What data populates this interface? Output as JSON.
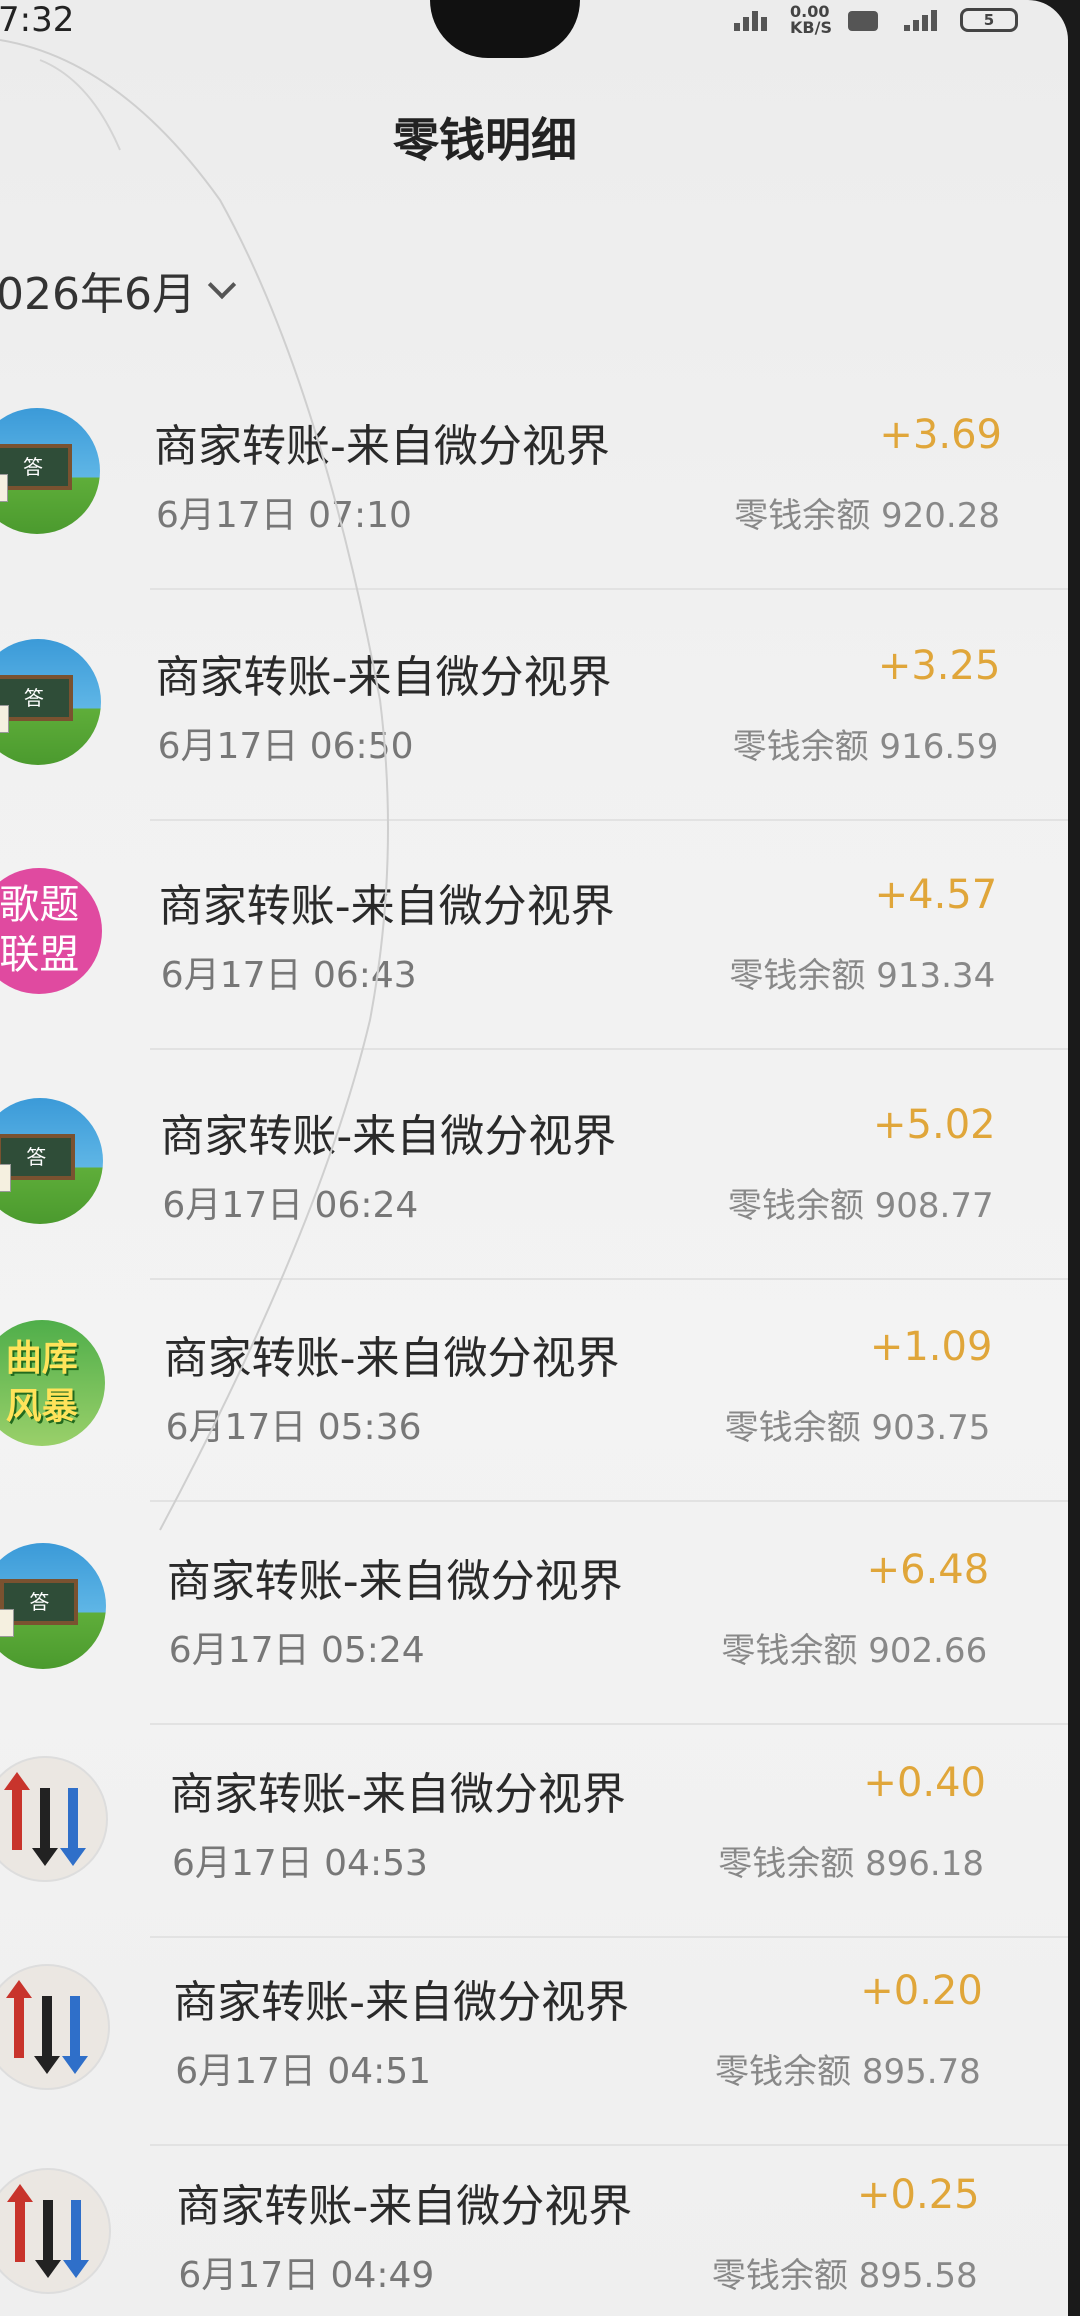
{
  "status_bar": {
    "time": "7:32",
    "signal_text_1": "0.00\nKB/S",
    "battery": "5"
  },
  "header": {
    "title": "零钱明细"
  },
  "filter": {
    "month": "026年6月"
  },
  "transactions": [
    {
      "avatar": "chalkboard-avatar",
      "avatar_text": "答",
      "title": "商家转账-来自微分视界",
      "time": "6月17日 07:10",
      "amount": "+3.69",
      "balance": "零钱余额 920.28"
    },
    {
      "avatar": "chalkboard-avatar",
      "avatar_text": "答",
      "title": "商家转账-来自微分视界",
      "time": "6月17日 06:50",
      "amount": "+3.25",
      "balance": "零钱余额 916.59"
    },
    {
      "avatar": "pink-text-avatar",
      "avatar_text": "歌题联盟",
      "title": "商家转账-来自微分视界",
      "time": "6月17日 06:43",
      "amount": "+4.57",
      "balance": "零钱余额 913.34"
    },
    {
      "avatar": "chalkboard-avatar",
      "avatar_text": "答",
      "title": "商家转账-来自微分视界",
      "time": "6月17日 06:24",
      "amount": "+5.02",
      "balance": "零钱余额 908.77"
    },
    {
      "avatar": "green-text-avatar",
      "avatar_text": "曲库风暴",
      "title": "商家转账-来自微分视界",
      "time": "6月17日 05:36",
      "amount": "+1.09",
      "balance": "零钱余额 903.75"
    },
    {
      "avatar": "chalkboard-avatar",
      "avatar_text": "答",
      "title": "商家转账-来自微分视界",
      "time": "6月17日 05:24",
      "amount": "+6.48",
      "balance": "零钱余额 902.66"
    },
    {
      "avatar": "arrows-avatar",
      "avatar_text": "",
      "title": "商家转账-来自微分视界",
      "time": "6月17日 04:53",
      "amount": "+0.40",
      "balance": "零钱余额 896.18"
    },
    {
      "avatar": "arrows-avatar",
      "avatar_text": "",
      "title": "商家转账-来自微分视界",
      "time": "6月17日 04:51",
      "amount": "+0.20",
      "balance": "零钱余额 895.78"
    },
    {
      "avatar": "arrows-avatar",
      "avatar_text": "",
      "title": "商家转账-来自微分视界",
      "time": "6月17日 04:49",
      "amount": "+0.25",
      "balance": "零钱余额 895.58"
    }
  ],
  "colors": {
    "amount": "#e0a63a",
    "arrow_red": "#c8342c",
    "arrow_black": "#222222",
    "arrow_blue": "#2f6fc9"
  }
}
